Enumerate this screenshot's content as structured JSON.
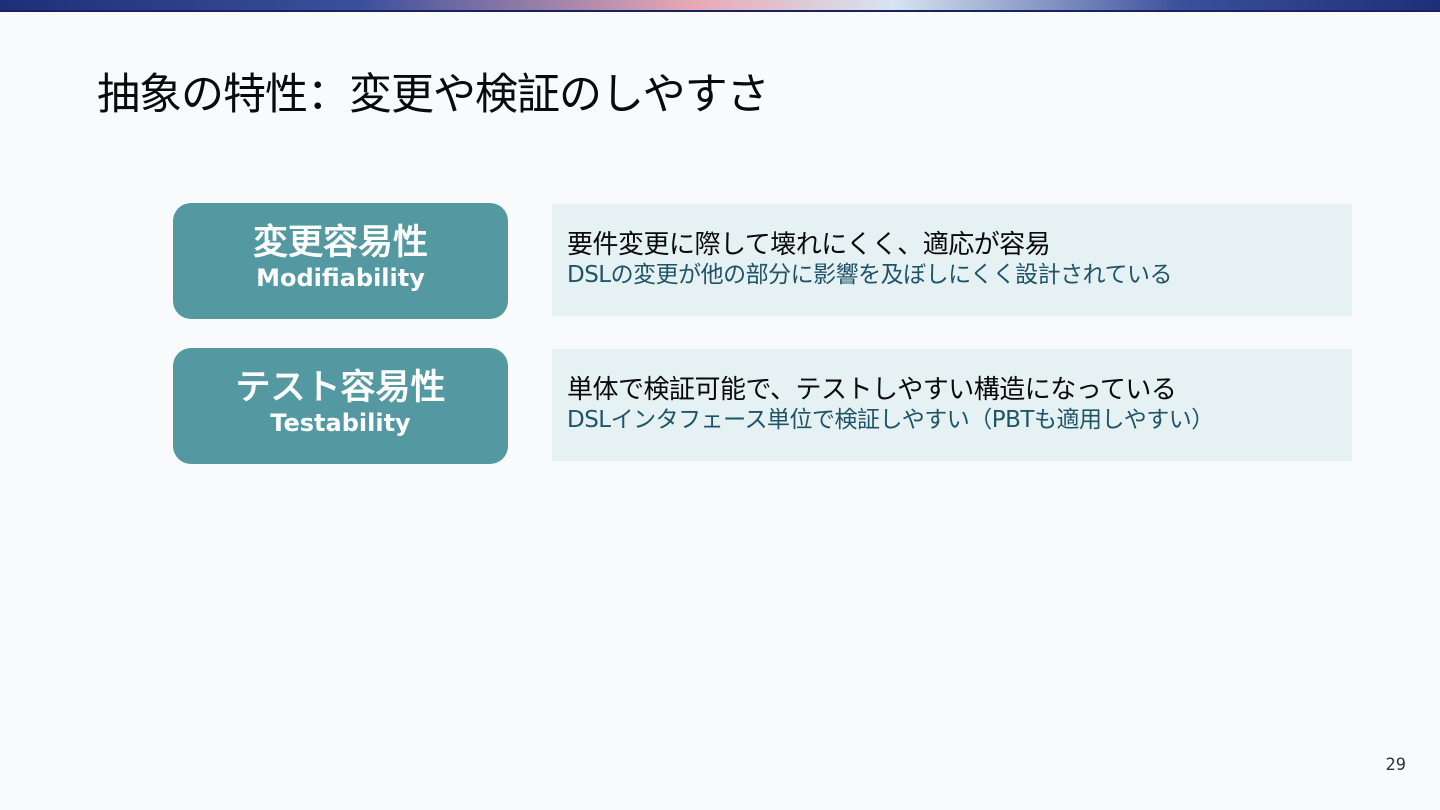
{
  "slide": {
    "title": "抽象の特性：変更や検証のしやすさ",
    "page_number": "29"
  },
  "items": [
    {
      "label_ja": "変更容易性",
      "label_en": "Modifiability",
      "description": "要件変更に際して壊れにくく、適応が容易",
      "detail": "DSLの変更が他の部分に影響を及ぼしにくく設計されている"
    },
    {
      "label_ja": "テスト容易性",
      "label_en": "Testability",
      "description": "単体で検証可能で、テストしやすい構造になっている",
      "detail": "DSLインタフェース単位で検証しやすい（PBTも適用しやすい）"
    }
  ],
  "colors": {
    "label_background": "#5499a1",
    "description_background": "#e5f1f2",
    "detail_text": "#1f5468"
  }
}
